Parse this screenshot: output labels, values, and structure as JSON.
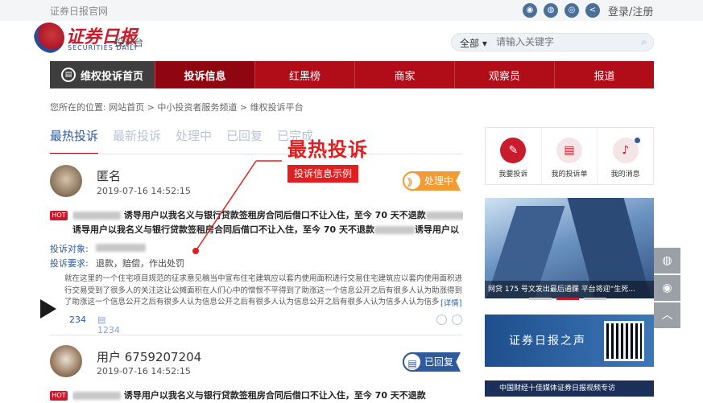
{
  "topbar": {
    "site": "证券日报官网",
    "login": "登录/注册",
    "share_icons": [
      "weibo-icon",
      "wechat-icon",
      "app-icon",
      "share-icon"
    ]
  },
  "logo": {
    "cn": "证券日报",
    "en": "SECURITIES DAILY",
    "sub": "投诉台"
  },
  "search": {
    "scope": "全部 ▾",
    "placeholder": "请输入关键字",
    "button": "⌕"
  },
  "nav": {
    "home": "维权投诉首页",
    "items": [
      "投诉信息",
      "红黑榜",
      "商家",
      "观察员",
      "报道"
    ]
  },
  "breadcrumb": "您所在的位置: 网站首页 > 中小投资者服务频道 > 维权投诉平台",
  "tabs": [
    "最热投诉",
    "最新投诉",
    "处理中",
    "已回复",
    "已完成"
  ],
  "annotation": {
    "big": "最热投诉",
    "small": "投诉信息示例"
  },
  "items": [
    {
      "user": "匿名",
      "date": "2019-07-16  14:52:15",
      "status": "处理中",
      "status_icon": "》",
      "hot": "HOT",
      "title1": "诱导用户以我名义与银行贷款签租房合同后借口不让入住，至今 70 天不退款",
      "title2": "诱导用户以我名义与银行贷款签租房合同后借口不让入住，至今 70 天不退款",
      "title2_end": "诱导用户以 ...",
      "target_label": "投诉对象:",
      "demand_label": "投诉要求:",
      "demand": "退款，赔偿，作出处罚",
      "body": "就在这里的一个住宅项目规范的征求意见稿当中宣布住宅建筑应以套内使用面积进行交易住宅建筑应以套内使用面积进行交易受到了很多人的关注这让公摊面积在人们心中的憎恨不平得到了助涨这一个信息公开之后有很多人认为助涨得到了助涨这一个信息公开之后有很多人认为信息公开之后有很多人认为信息公开之后有很多人认为信多人认为信多人认为信多人认 ...",
      "detail": "[详情]",
      "views": "234",
      "comments": "1234"
    },
    {
      "user": "用户 6759207204",
      "date": "2019-07-16  14:52:15",
      "status": "已回复",
      "status_icon": "▤",
      "hot": "HOT",
      "title1": "诱导用户以我名义与银行贷款签租房合同后借口不让入住，至今 70 天不退款"
    }
  ],
  "quick": [
    {
      "label": "我要投诉",
      "icon": "✎"
    },
    {
      "label": "我的投诉单",
      "icon": "▤"
    },
    {
      "label": "我的消息",
      "icon": "♪"
    }
  ],
  "banner": {
    "caption": "网贷 175 号文发出最后通牒 平台将迎“生死..."
  },
  "voice": {
    "title": "证券日报之声"
  },
  "bottom_banner": "中国财经十佳媒体证券日报视频专访",
  "float_icons": [
    "wechat-icon",
    "weibo-icon",
    "back-to-top-icon"
  ]
}
